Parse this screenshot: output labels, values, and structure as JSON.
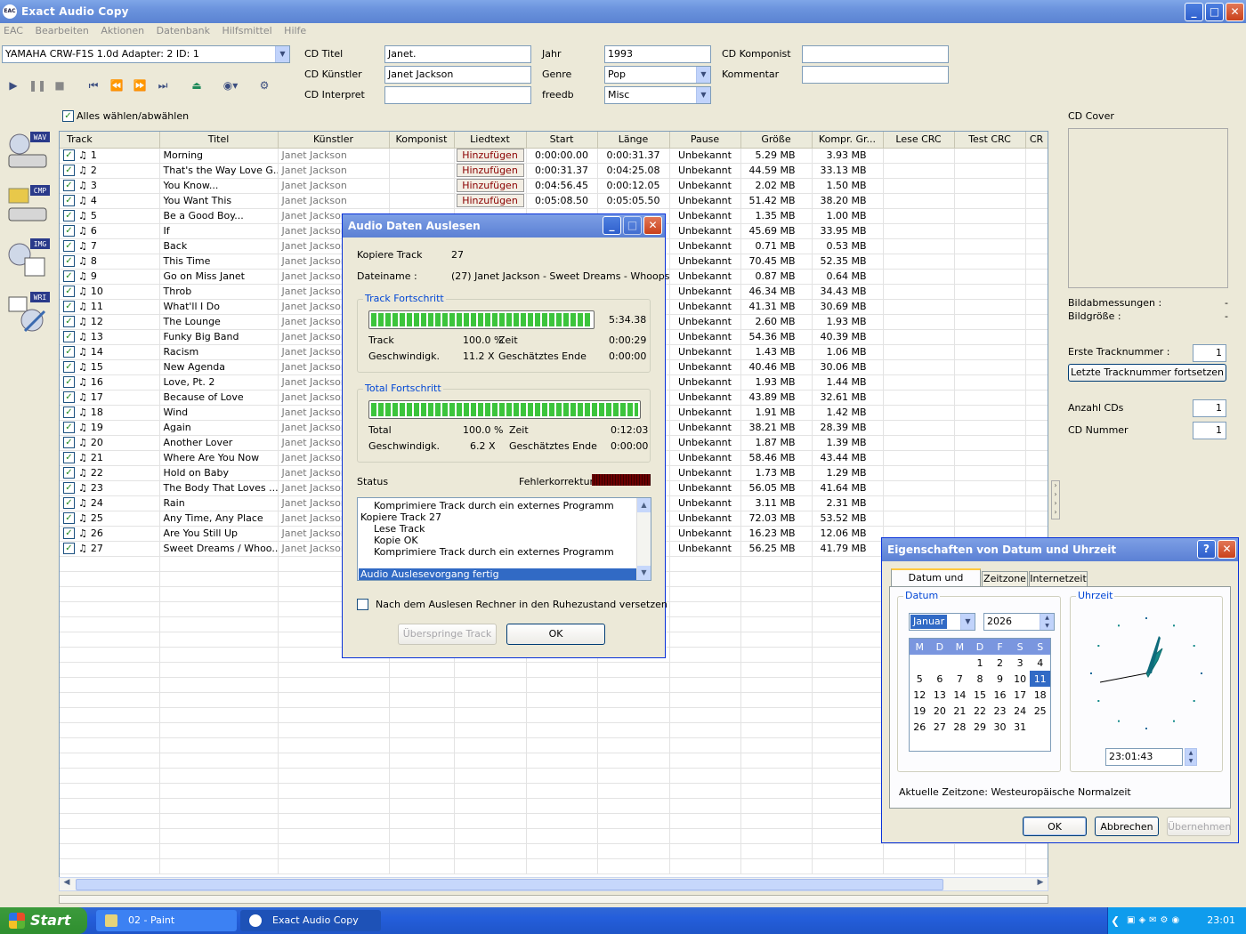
{
  "app": {
    "title": "Exact Audio Copy",
    "logo_text": "EAC"
  },
  "menu": [
    "EAC",
    "Bearbeiten",
    "Aktionen",
    "Datenbank",
    "Hilfsmittel",
    "Hilfe"
  ],
  "drive": "YAMAHA  CRW-F1S 1.0d  Adapter: 2  ID: 1",
  "cdinfo": {
    "titel_label": "CD Titel",
    "titel": "Janet.",
    "kuenstler_label": "CD Künstler",
    "kuenstler": "Janet Jackson",
    "interpret_label": "CD Interpret",
    "interpret": "",
    "jahr_label": "Jahr",
    "jahr": "1993",
    "genre_label": "Genre",
    "genre": "Pop",
    "freedb_label": "freedb",
    "freedb": "Misc",
    "komponist_label": "CD Komponist",
    "komponist": "",
    "kommentar_label": "Kommentar",
    "kommentar": ""
  },
  "select_all": "Alles wählen/abwählen",
  "side_buttons": [
    "WAV",
    "CMP",
    "IMG",
    "WRI"
  ],
  "columns": [
    "Track",
    "Titel",
    "Künstler",
    "Komponist",
    "Liedtext",
    "Start",
    "Länge",
    "Pause",
    "Größe",
    "Kompr. Gr...",
    "Lese CRC",
    "Test CRC",
    "CR"
  ],
  "lyric_button": "Hinzufügen",
  "tracks": [
    {
      "n": "1",
      "title": "Morning",
      "artist": "Janet Jackson",
      "start": "0:00:00.00",
      "len": "0:00:31.37",
      "pause": "Unbekannt",
      "size": "5.29 MB",
      "comp": "3.93 MB"
    },
    {
      "n": "2",
      "title": "That's the Way Love G...",
      "artist": "Janet Jackson",
      "start": "0:00:31.37",
      "len": "0:04:25.08",
      "pause": "Unbekannt",
      "size": "44.59 MB",
      "comp": "33.13 MB"
    },
    {
      "n": "3",
      "title": "You Know...",
      "artist": "Janet Jackson",
      "start": "0:04:56.45",
      "len": "0:00:12.05",
      "pause": "Unbekannt",
      "size": "2.02 MB",
      "comp": "1.50 MB"
    },
    {
      "n": "4",
      "title": "You Want This",
      "artist": "Janet Jackson",
      "start": "0:05:08.50",
      "len": "0:05:05.50",
      "pause": "Unbekannt",
      "size": "51.42 MB",
      "comp": "38.20 MB"
    },
    {
      "n": "5",
      "title": "Be a Good Boy...",
      "artist": "Janet Jackson",
      "start": "",
      "len": "",
      "pause": "Unbekannt",
      "size": "1.35 MB",
      "comp": "1.00 MB"
    },
    {
      "n": "6",
      "title": "If",
      "artist": "Janet Jackson",
      "start": "",
      "len": "",
      "pause": "Unbekannt",
      "size": "45.69 MB",
      "comp": "33.95 MB"
    },
    {
      "n": "7",
      "title": "Back",
      "artist": "Janet Jackson",
      "start": "",
      "len": "",
      "pause": "Unbekannt",
      "size": "0.71 MB",
      "comp": "0.53 MB"
    },
    {
      "n": "8",
      "title": "This Time",
      "artist": "Janet Jackson",
      "start": "",
      "len": "",
      "pause": "Unbekannt",
      "size": "70.45 MB",
      "comp": "52.35 MB"
    },
    {
      "n": "9",
      "title": "Go on Miss Janet",
      "artist": "Janet Jackson",
      "start": "",
      "len": "",
      "pause": "Unbekannt",
      "size": "0.87 MB",
      "comp": "0.64 MB"
    },
    {
      "n": "10",
      "title": "Throb",
      "artist": "Janet Jackson",
      "start": "",
      "len": "",
      "pause": "Unbekannt",
      "size": "46.34 MB",
      "comp": "34.43 MB"
    },
    {
      "n": "11",
      "title": "What'll I Do",
      "artist": "Janet Jackson",
      "start": "",
      "len": "",
      "pause": "Unbekannt",
      "size": "41.31 MB",
      "comp": "30.69 MB"
    },
    {
      "n": "12",
      "title": "The Lounge",
      "artist": "Janet Jackson",
      "start": "",
      "len": "",
      "pause": "Unbekannt",
      "size": "2.60 MB",
      "comp": "1.93 MB"
    },
    {
      "n": "13",
      "title": "Funky Big Band",
      "artist": "Janet Jackson",
      "start": "",
      "len": "",
      "pause": "Unbekannt",
      "size": "54.36 MB",
      "comp": "40.39 MB"
    },
    {
      "n": "14",
      "title": "Racism",
      "artist": "Janet Jackson",
      "start": "",
      "len": "",
      "pause": "Unbekannt",
      "size": "1.43 MB",
      "comp": "1.06 MB"
    },
    {
      "n": "15",
      "title": "New Agenda",
      "artist": "Janet Jackson",
      "start": "",
      "len": "",
      "pause": "Unbekannt",
      "size": "40.46 MB",
      "comp": "30.06 MB"
    },
    {
      "n": "16",
      "title": "Love, Pt. 2",
      "artist": "Janet Jackson",
      "start": "",
      "len": "",
      "pause": "Unbekannt",
      "size": "1.93 MB",
      "comp": "1.44 MB"
    },
    {
      "n": "17",
      "title": "Because of Love",
      "artist": "Janet Jackson",
      "start": "",
      "len": "",
      "pause": "Unbekannt",
      "size": "43.89 MB",
      "comp": "32.61 MB"
    },
    {
      "n": "18",
      "title": "Wind",
      "artist": "Janet Jackson",
      "start": "",
      "len": "",
      "pause": "Unbekannt",
      "size": "1.91 MB",
      "comp": "1.42 MB"
    },
    {
      "n": "19",
      "title": "Again",
      "artist": "Janet Jackson",
      "start": "",
      "len": "",
      "pause": "Unbekannt",
      "size": "38.21 MB",
      "comp": "28.39 MB"
    },
    {
      "n": "20",
      "title": "Another Lover",
      "artist": "Janet Jackson",
      "start": "",
      "len": "",
      "pause": "Unbekannt",
      "size": "1.87 MB",
      "comp": "1.39 MB"
    },
    {
      "n": "21",
      "title": "Where Are You Now",
      "artist": "Janet Jackson",
      "start": "",
      "len": "",
      "pause": "Unbekannt",
      "size": "58.46 MB",
      "comp": "43.44 MB"
    },
    {
      "n": "22",
      "title": "Hold on Baby",
      "artist": "Janet Jackson",
      "start": "",
      "len": "",
      "pause": "Unbekannt",
      "size": "1.73 MB",
      "comp": "1.29 MB"
    },
    {
      "n": "23",
      "title": "The Body That Loves ...",
      "artist": "Janet Jackson",
      "start": "",
      "len": "",
      "pause": "Unbekannt",
      "size": "56.05 MB",
      "comp": "41.64 MB"
    },
    {
      "n": "24",
      "title": "Rain",
      "artist": "Janet Jackson",
      "start": "",
      "len": "",
      "pause": "Unbekannt",
      "size": "3.11 MB",
      "comp": "2.31 MB"
    },
    {
      "n": "25",
      "title": "Any Time, Any Place",
      "artist": "Janet Jackson",
      "start": "",
      "len": "",
      "pause": "Unbekannt",
      "size": "72.03 MB",
      "comp": "53.52 MB"
    },
    {
      "n": "26",
      "title": "Are You Still Up",
      "artist": "Janet Jackson",
      "start": "",
      "len": "",
      "pause": "Unbekannt",
      "size": "16.23 MB",
      "comp": "12.06 MB"
    },
    {
      "n": "27",
      "title": "Sweet Dreams / Whoo...",
      "artist": "Janet Jackson",
      "start": "",
      "len": "",
      "pause": "Unbekannt",
      "size": "56.25 MB",
      "comp": "41.79 MB"
    }
  ],
  "right": {
    "cover_label": "CD Cover",
    "bildabm": "Bildabmessungen :",
    "bildgr": "Bildgröße :",
    "dash": "-",
    "erste_label": "Erste Tracknummer :",
    "erste": "1",
    "fortsetzen": "Letzte Tracknummer fortsetzen",
    "anzahl_label": "Anzahl CDs",
    "anzahl": "1",
    "nummer_label": "CD Nummer",
    "nummer": "1"
  },
  "extract": {
    "title": "Audio Daten Auslesen",
    "kopiere_label": "Kopiere Track",
    "kopiere": "27",
    "datei_label": "Dateiname :",
    "datei": "(27) Janet Jackson - Sweet Dreams - Whoops",
    "track_group": "Track Fortschritt",
    "track_progress": 1.0,
    "track_time": "5:34.38",
    "track_label": "Track",
    "track_pct": "100.0 %",
    "zeit_label": "Zeit",
    "track_zeit": "0:00:29",
    "geschw_label": "Geschwindigk.",
    "track_speed": "11.2 X",
    "ende_label": "Geschätztes Ende",
    "track_ende": "0:00:00",
    "total_group": "Total Fortschritt",
    "total_progress": 1.0,
    "total_label": "Total",
    "total_pct": "100.0 %",
    "total_zeit": "0:12:03",
    "total_speed": "6.2 X",
    "total_ende": "0:00:00",
    "status_label": "Status",
    "fehler_label": "Fehlerkorrektur :",
    "log": [
      "Komprimiere Track durch ein externes Programm",
      "Kopiere Track 27",
      "Lese Track",
      "Kopie OK",
      "Komprimiere Track durch ein externes Programm"
    ],
    "log_selected": "Audio Auslesevorgang fertig",
    "standby": "Nach dem Auslesen Rechner in den Ruhezustand versetzen",
    "skip": "Überspringe Track",
    "ok": "OK"
  },
  "datetime": {
    "title": "Eigenschaften von Datum und Uhrzeit",
    "tabs": [
      "Datum und Uhrzeit",
      "Zeitzone",
      "Internetzeit"
    ],
    "datum_group": "Datum",
    "uhrzeit_group": "Uhrzeit",
    "month": "Januar",
    "year": "2026",
    "weekdays": [
      "M",
      "D",
      "M",
      "D",
      "F",
      "S",
      "S"
    ],
    "days": [
      [
        "",
        "",
        "",
        "1",
        "2",
        "3",
        "4"
      ],
      [
        "5",
        "6",
        "7",
        "8",
        "9",
        "10",
        "11"
      ],
      [
        "12",
        "13",
        "14",
        "15",
        "16",
        "17",
        "18"
      ],
      [
        "19",
        "20",
        "21",
        "22",
        "23",
        "24",
        "25"
      ],
      [
        "26",
        "27",
        "28",
        "29",
        "30",
        "31",
        ""
      ]
    ],
    "selected_day": "11",
    "time": "23:01:43",
    "zone": "Aktuelle Zeitzone: Westeuropäische Normalzeit",
    "ok": "OK",
    "cancel": "Abbrechen",
    "apply": "Übernehmen"
  },
  "taskbar": {
    "start": "Start",
    "tasks": [
      "02 - Paint",
      "Exact Audio Copy"
    ],
    "clock": "23:01"
  }
}
